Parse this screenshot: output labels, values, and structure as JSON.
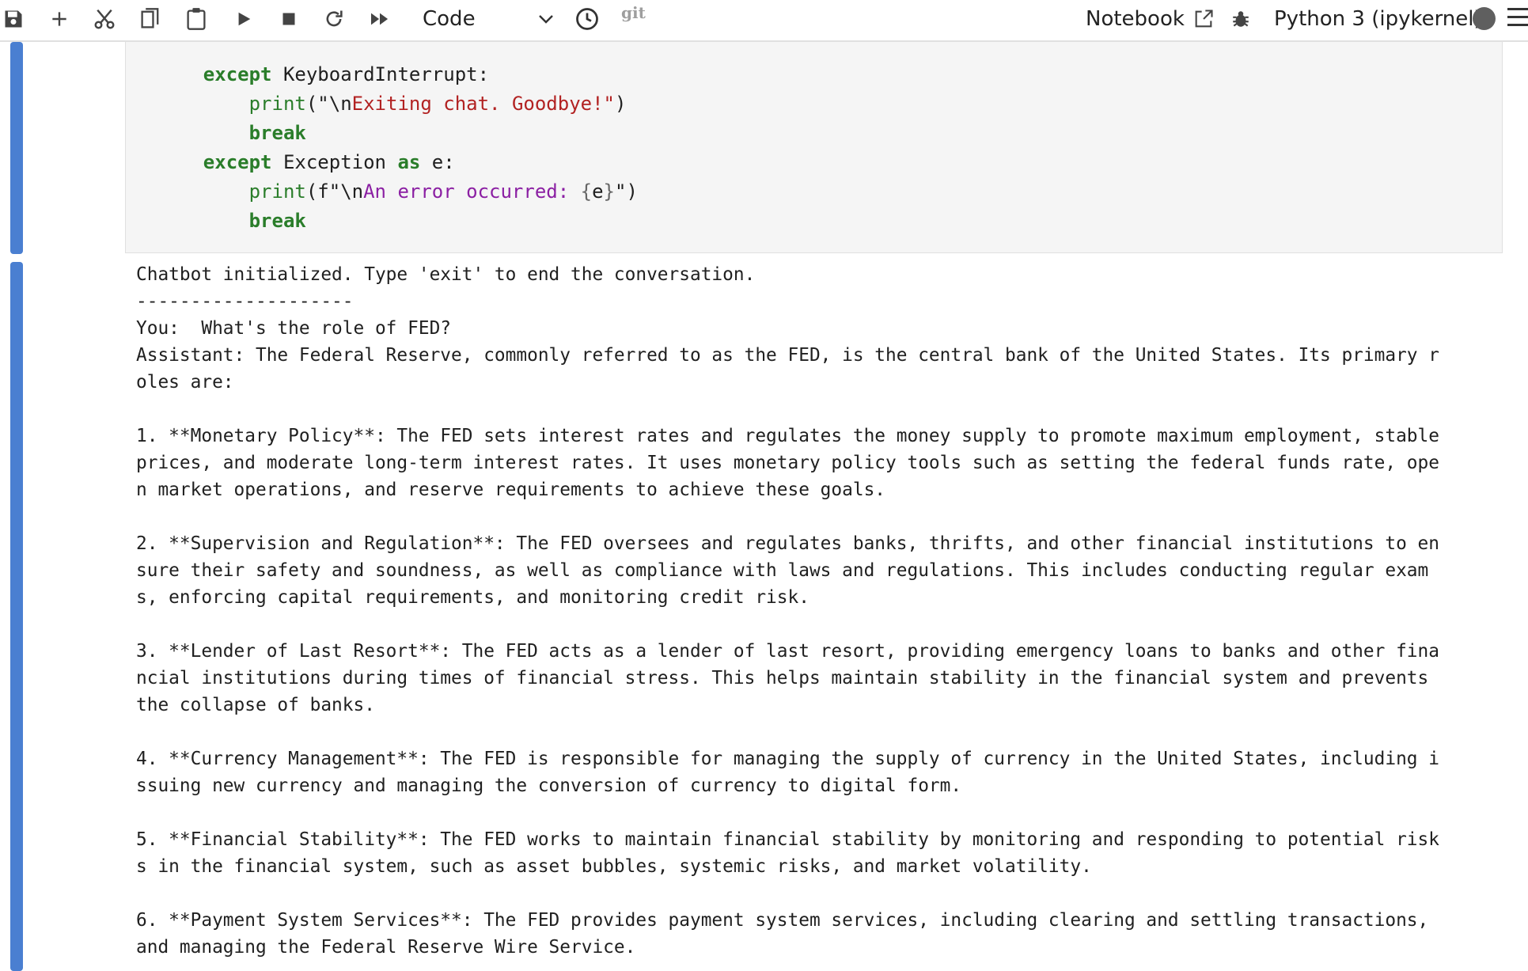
{
  "toolbar": {
    "buttons": [
      {
        "name": "save-button",
        "icon": "save-icon"
      },
      {
        "name": "insert-cell-button",
        "icon": "plus-icon"
      },
      {
        "name": "cut-button",
        "icon": "scissors-icon"
      },
      {
        "name": "copy-button",
        "icon": "copy-icon"
      },
      {
        "name": "paste-button",
        "icon": "clipboard-icon"
      },
      {
        "name": "run-button",
        "icon": "play-icon"
      },
      {
        "name": "interrupt-button",
        "icon": "stop-icon"
      },
      {
        "name": "restart-button",
        "icon": "restart-icon"
      },
      {
        "name": "restart-run-all-button",
        "icon": "fast-forward-icon"
      }
    ],
    "cell_type": "Code",
    "git_label": "git",
    "notebook_label": "Notebook",
    "kernel_name": "Python 3 (ipykernel)"
  },
  "code_cell": {
    "lines": [
      {
        "indent": "    ",
        "parts": [
          {
            "t": "except",
            "c": "kw"
          },
          {
            "t": " KeyboardInterrupt:",
            "c": ""
          }
        ]
      },
      {
        "indent": "        ",
        "parts": [
          {
            "t": "print",
            "c": "fn"
          },
          {
            "t": "(",
            "c": ""
          },
          {
            "t": "\"\\n",
            "c": ""
          },
          {
            "t": "Exiting chat. Goodbye!\"",
            "c": "str"
          },
          {
            "t": ")",
            "c": ""
          }
        ]
      },
      {
        "indent": "        ",
        "parts": [
          {
            "t": "break",
            "c": "kw"
          }
        ]
      },
      {
        "indent": "    ",
        "parts": [
          {
            "t": "except",
            "c": "kw"
          },
          {
            "t": " Exception ",
            "c": ""
          },
          {
            "t": "as",
            "c": "kw"
          },
          {
            "t": " e:",
            "c": ""
          }
        ]
      },
      {
        "indent": "        ",
        "parts": [
          {
            "t": "print",
            "c": "fn"
          },
          {
            "t": "(f\"\\n",
            "c": ""
          },
          {
            "t": "An error occurred: ",
            "c": "fstr"
          },
          {
            "t": "{",
            "c": "brace"
          },
          {
            "t": "e",
            "c": ""
          },
          {
            "t": "}",
            "c": "brace"
          },
          {
            "t": "\")",
            "c": ""
          }
        ]
      },
      {
        "indent": "        ",
        "parts": [
          {
            "t": "break",
            "c": "kw"
          }
        ]
      }
    ]
  },
  "output": {
    "lines": [
      "Chatbot initialized. Type 'exit' to end the conversation.",
      "--------------------",
      "You:  What's the role of FED?",
      "Assistant: The Federal Reserve, commonly referred to as the FED, is the central bank of the United States. Its primary r",
      "oles are:",
      "",
      "1. **Monetary Policy**: The FED sets interest rates and regulates the money supply to promote maximum employment, stable",
      "prices, and moderate long-term interest rates. It uses monetary policy tools such as setting the federal funds rate, ope",
      "n market operations, and reserve requirements to achieve these goals.",
      "",
      "2. **Supervision and Regulation**: The FED oversees and regulates banks, thrifts, and other financial institutions to en",
      "sure their safety and soundness, as well as compliance with laws and regulations. This includes conducting regular exam",
      "s, enforcing capital requirements, and monitoring credit risk.",
      "",
      "3. **Lender of Last Resort**: The FED acts as a lender of last resort, providing emergency loans to banks and other fina",
      "ncial institutions during times of financial stress. This helps maintain stability in the financial system and prevents",
      "the collapse of banks.",
      "",
      "4. **Currency Management**: The FED is responsible for managing the supply of currency in the United States, including i",
      "ssuing new currency and managing the conversion of currency to digital form.",
      "",
      "5. **Financial Stability**: The FED works to maintain financial stability by monitoring and responding to potential risk",
      "s in the financial system, such as asset bubbles, systemic risks, and market volatility.",
      "",
      "6. **Payment System Services**: The FED provides payment system services, including clearing and settling transactions,",
      "and managing the Federal Reserve Wire Service."
    ]
  },
  "colors": {
    "accent": "#4a7fd1",
    "keyword": "#2a7d2a",
    "string": "#b22222",
    "fstring": "#8b1fa3"
  }
}
